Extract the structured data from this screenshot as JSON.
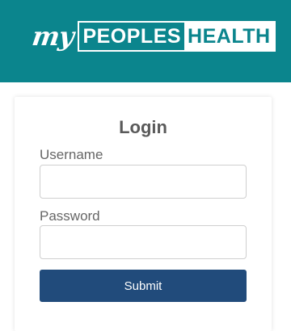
{
  "brand": {
    "prefix": "my",
    "name_part1": "PEOPLES",
    "name_part2": "HEALTH",
    "colors": {
      "header_bg": "#0b858d",
      "button_bg": "#214b7b"
    }
  },
  "login": {
    "title": "Login",
    "username_label": "Username",
    "username_value": "",
    "password_label": "Password",
    "password_value": "",
    "submit_label": "Submit"
  }
}
